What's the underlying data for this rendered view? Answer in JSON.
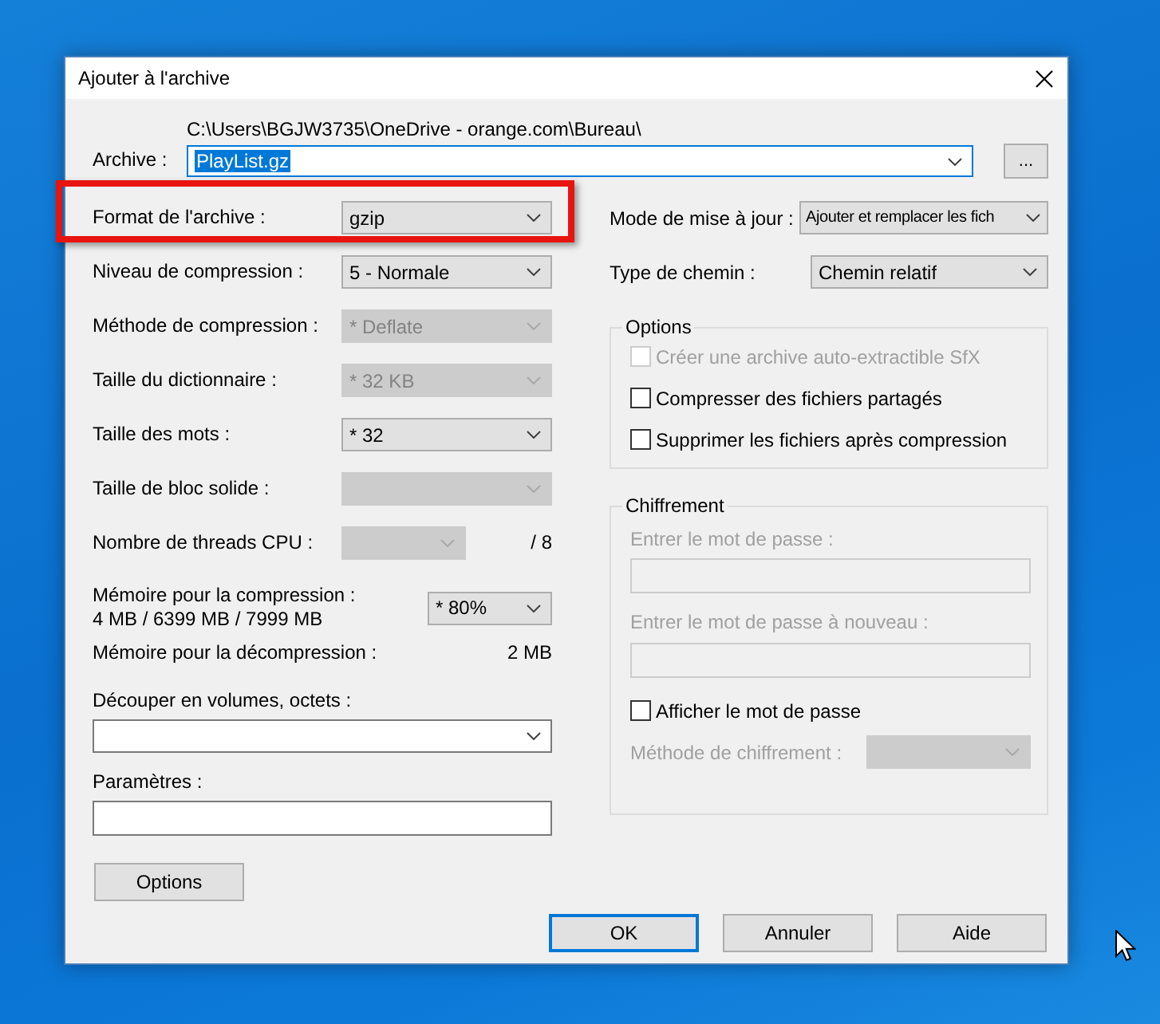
{
  "window": {
    "title": "Ajouter à l'archive"
  },
  "archive": {
    "label": "Archive :",
    "path": "C:\\Users\\BGJW3735\\OneDrive - orange.com\\Bureau\\",
    "value": "PlayList.gz",
    "text_selected": true,
    "browse": "..."
  },
  "left_rows": [
    {
      "kind": "combo",
      "label": "Format de l'archive :",
      "value": "gzip",
      "disabled": false,
      "highlighted": true
    },
    {
      "kind": "combo",
      "label": "Niveau de compression :",
      "value": "5 - Normale",
      "disabled": false,
      "highlighted": false
    },
    {
      "kind": "combo",
      "label": "Méthode de compression :",
      "value": "*  Deflate",
      "disabled": true,
      "highlighted": false
    },
    {
      "kind": "combo",
      "label": "Taille du dictionnaire :",
      "value": "*  32 KB",
      "disabled": true,
      "highlighted": false
    },
    {
      "kind": "combo",
      "label": "Taille des mots :",
      "value": "*  32",
      "disabled": false,
      "highlighted": false
    },
    {
      "kind": "combo",
      "label": "Taille de bloc solide :",
      "disabled": true,
      "highlighted": false
    },
    {
      "kind": "threads",
      "label": "Nombre de threads CPU :",
      "suffix": "/ 8",
      "disabled": true,
      "highlighted": false
    },
    {
      "kind": "memory",
      "label": "Mémoire pour la compression :",
      "detail": "4 MB / 6399 MB / 7999 MB",
      "value": "*  80%",
      "disabled": false,
      "highlighted": false
    },
    {
      "kind": "info",
      "label": "Mémoire pour la décompression :",
      "value": "2 MB",
      "highlighted": false
    }
  ],
  "split": {
    "label": "Découper en volumes, octets :"
  },
  "parameters": {
    "label": "Paramètres :"
  },
  "options_button": "Options",
  "update_mode": {
    "label": "Mode de mise à jour :",
    "value": "Ajouter et remplacer les fich"
  },
  "path_type": {
    "label": "Type de chemin :",
    "value": "Chemin relatif"
  },
  "options": {
    "title": "Options",
    "items": [
      {
        "label": "Créer une archive auto-extractible SfX",
        "checked": false,
        "disabled": true
      },
      {
        "label": "Compresser des fichiers partagés",
        "checked": false,
        "disabled": false
      },
      {
        "label": "Supprimer les fichiers après compression",
        "checked": false,
        "disabled": false
      }
    ]
  },
  "encryption": {
    "title": "Chiffrement",
    "password_label": "Entrer le mot de passe :",
    "repeat_label": "Entrer le mot de passe à nouveau :",
    "show_password": {
      "label": "Afficher le mot de passe",
      "checked": false,
      "disabled": false
    },
    "method_label": "Méthode de chiffrement :",
    "disabled": true
  },
  "buttons": [
    {
      "label": "OK",
      "default": true
    },
    {
      "label": "Annuler",
      "default": false
    },
    {
      "label": "Aide",
      "default": false
    }
  ]
}
